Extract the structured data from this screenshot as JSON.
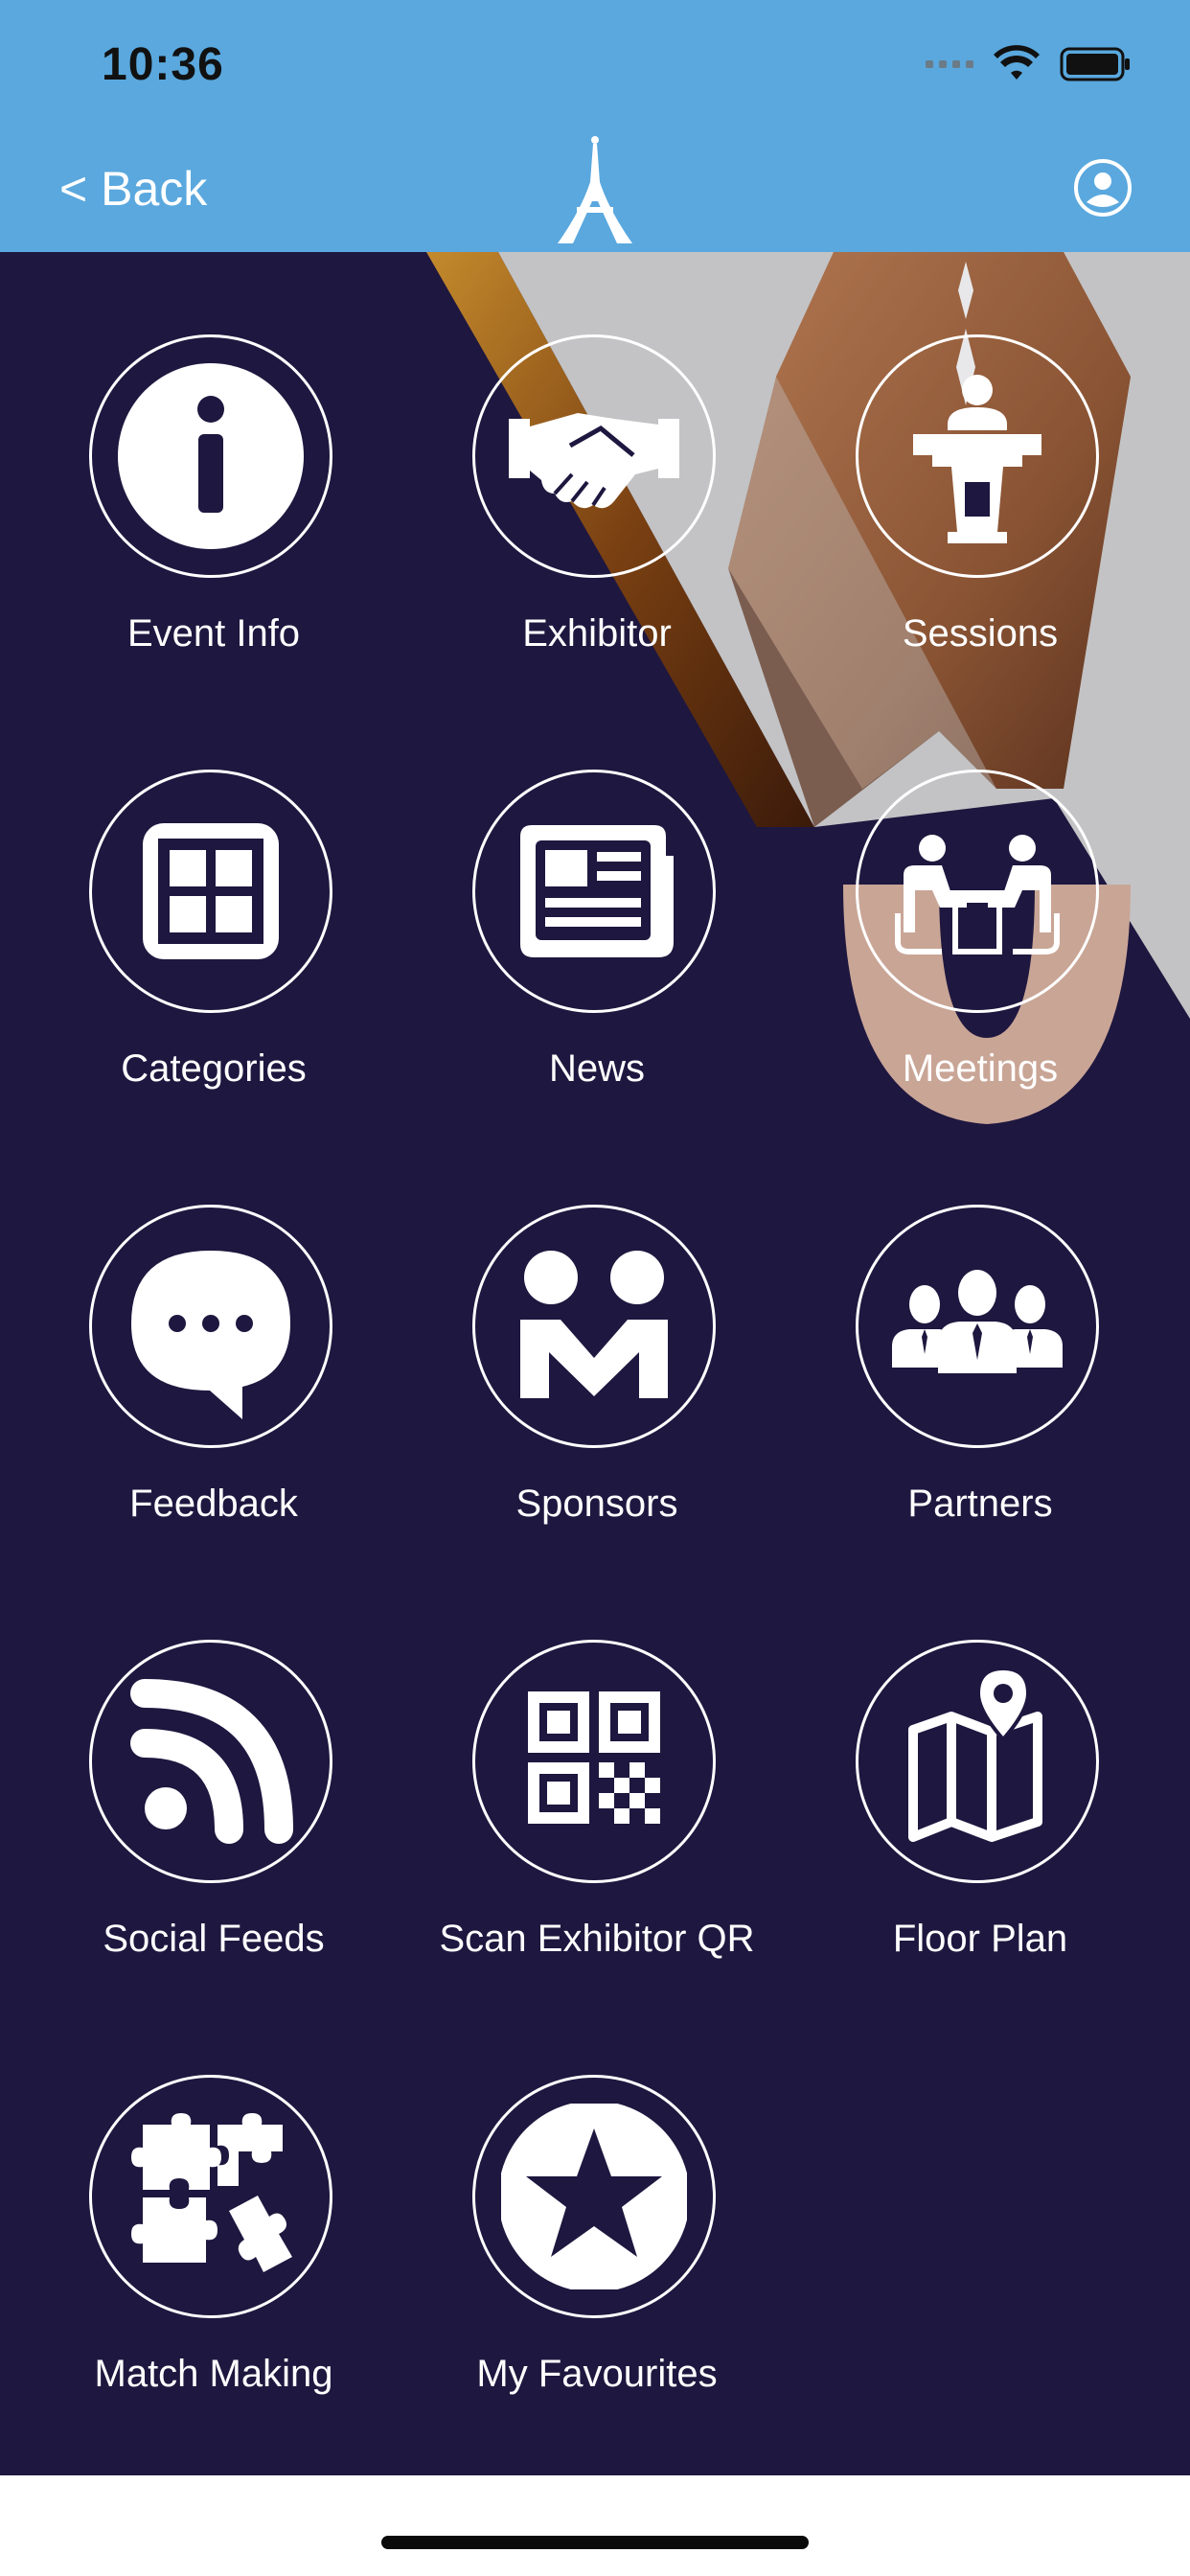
{
  "status_bar": {
    "time": "10:36"
  },
  "nav": {
    "back_label": "< Back"
  },
  "tiles": [
    {
      "label": "Event Info",
      "icon": "info-icon"
    },
    {
      "label": "Exhibitor",
      "icon": "handshake-icon"
    },
    {
      "label": "Sessions",
      "icon": "speaker-podium-icon"
    },
    {
      "label": "Categories",
      "icon": "categories-grid-icon"
    },
    {
      "label": "News",
      "icon": "newspaper-icon"
    },
    {
      "label": "Meetings",
      "icon": "meeting-icon"
    },
    {
      "label": "Feedback",
      "icon": "chat-bubble-icon"
    },
    {
      "label": "Sponsors",
      "icon": "sponsors-icon"
    },
    {
      "label": "Partners",
      "icon": "people-group-icon"
    },
    {
      "label": "Social Feeds",
      "icon": "rss-icon"
    },
    {
      "label": "Scan Exhibitor QR",
      "icon": "qr-code-icon"
    },
    {
      "label": "Floor Plan",
      "icon": "map-pin-icon"
    },
    {
      "label": "Match Making",
      "icon": "puzzle-icon"
    },
    {
      "label": "My Favourites",
      "icon": "star-icon"
    }
  ],
  "colors": {
    "header": "#5aa8de",
    "background": "#1e173f",
    "text": "#ffffff"
  }
}
